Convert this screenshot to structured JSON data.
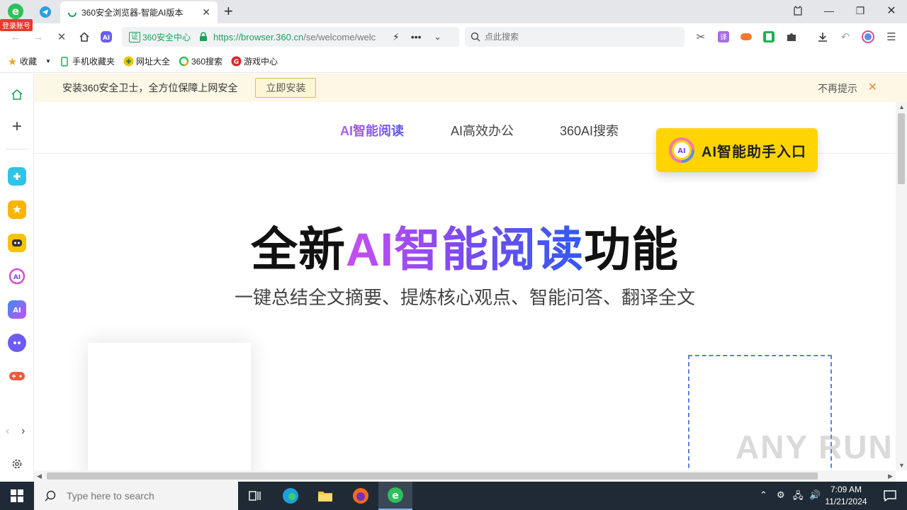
{
  "browser": {
    "login_badge": "登录账号",
    "tab_title": "360安全浏览器-智能AI版本",
    "new_tab_symbol": "+",
    "address": {
      "security_label": "360安全中心",
      "cert_char": "证",
      "url_host": "https://browser.360.cn",
      "url_path": "/se/welcome/welc"
    },
    "search_placeholder": "点此搜索",
    "bookmarks": [
      {
        "label": "收藏",
        "icon": "star-icon"
      },
      {
        "label": "手机收藏夹",
        "icon": "phone-icon"
      },
      {
        "label": "网址大全",
        "icon": "nav-site-icon"
      },
      {
        "label": "360搜索",
        "icon": "so360-icon"
      },
      {
        "label": "游戏中心",
        "icon": "game-center-icon"
      }
    ]
  },
  "notification": {
    "message": "安装360安全卫士，全方位保障上网安全",
    "install_label": "立即安装",
    "dismiss_label": "不再提示"
  },
  "page": {
    "nav": [
      "AI智能阅读",
      "AI高效办公",
      "360AI搜索"
    ],
    "ai_entry_label": "AI智能助手入口",
    "ai_badge": "AI",
    "hero_prefix": "全新",
    "hero_highlight": "AI智能阅读",
    "hero_suffix": "功能",
    "hero_subtitle": "一键总结全文摘要、提炼核心观点、智能问答、翻译全文"
  },
  "watermark": "ANY RUN",
  "taskbar": {
    "search_placeholder": "Type here to search",
    "time": "7:09 AM",
    "date": "11/21/2024"
  },
  "colors": {
    "accent_green": "#19a25e",
    "ai_button_yellow": "#ffd400",
    "gradient_start": "#c84ef0",
    "gradient_end": "#2f5bef",
    "notification_bg": "#fdf8e6"
  }
}
